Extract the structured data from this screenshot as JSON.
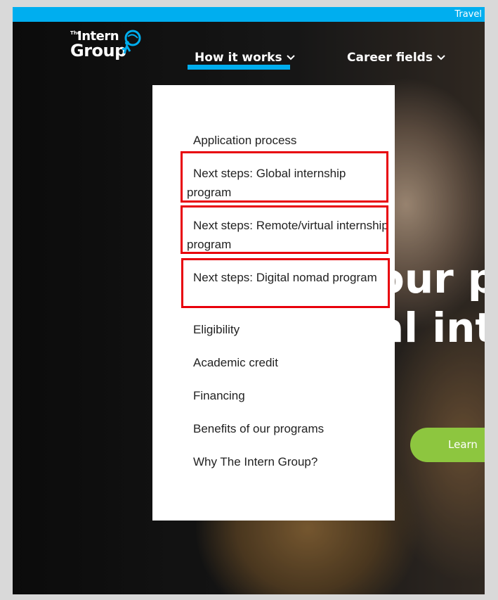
{
  "topbar": {
    "travel_label": "Travel"
  },
  "logo": {
    "the": "The",
    "intern": "Intern",
    "group": "Group"
  },
  "nav": {
    "how_it_works": "How it works",
    "career_fields": "Career fields"
  },
  "hero": {
    "line1": "our p",
    "line2": "al int",
    "learn_button": "Learn"
  },
  "dropdown": {
    "items": [
      "Application process",
      "Next steps: Global internship program",
      "Next steps: Remote/virtual internship program",
      "Next steps: Digital nomad program",
      "Eligibility",
      "Academic credit",
      "Financing",
      "Benefits of our programs",
      "Why The Intern Group?"
    ]
  },
  "colors": {
    "accent_blue": "#00aeef",
    "accent_green": "#8dc63f",
    "highlight_red": "#e8000b"
  }
}
